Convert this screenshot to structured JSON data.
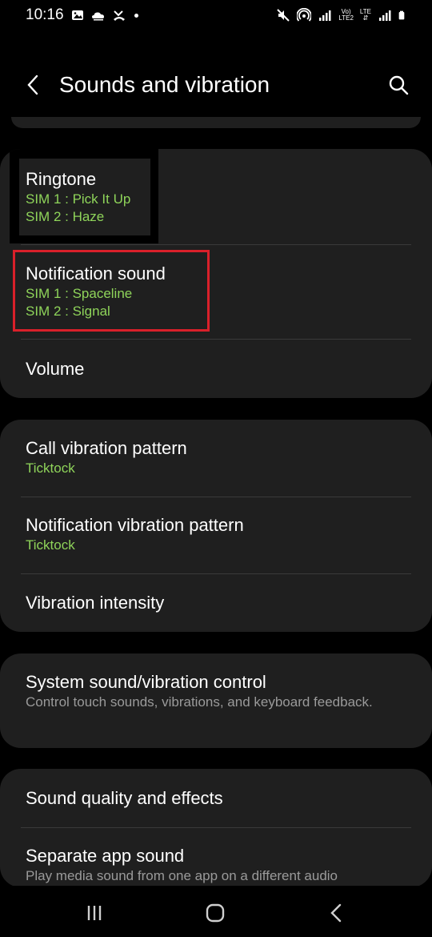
{
  "status_bar": {
    "time": "10:16",
    "volte_label": "Vo)",
    "lte2_label": "LTE2",
    "lte_label": "LTE"
  },
  "header": {
    "title": "Sounds and vibration"
  },
  "groups": [
    {
      "items": [
        {
          "title": "Ringtone",
          "sim1": "SIM 1 : Pick It Up",
          "sim2": "SIM 2 : Haze"
        },
        {
          "title": "Notification sound",
          "sim1": "SIM 1 : Spaceline",
          "sim2": "SIM 2 : Signal"
        },
        {
          "title": "Volume"
        }
      ]
    },
    {
      "items": [
        {
          "title": "Call vibration pattern",
          "sub": "Ticktock"
        },
        {
          "title": "Notification vibration pattern",
          "sub": "Ticktock"
        },
        {
          "title": "Vibration intensity"
        }
      ]
    },
    {
      "items": [
        {
          "title": "System sound/vibration control",
          "desc": "Control touch sounds, vibrations, and keyboard feedback."
        }
      ]
    },
    {
      "items": [
        {
          "title": "Sound quality and effects"
        },
        {
          "title": "Separate app sound",
          "desc": "Play media sound from one app on a different audio"
        }
      ]
    }
  ],
  "colors": {
    "accent_green": "#8fd45a",
    "highlight_red": "#d9202a",
    "card_bg": "#1f1f1f"
  }
}
